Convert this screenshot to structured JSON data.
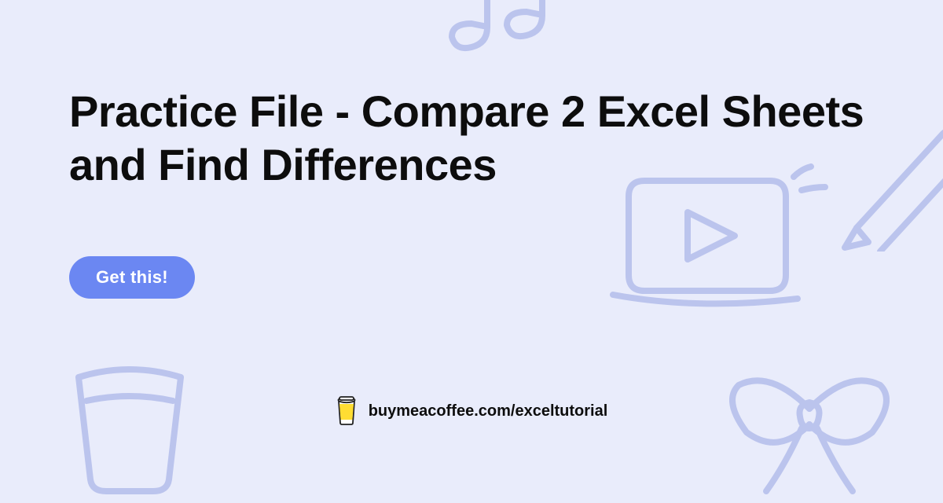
{
  "title": "Practice File - Compare 2 Excel Sheets and Find Differences",
  "cta_label": "Get this!",
  "footer_url": "buymeacoffee.com/exceltutorial"
}
